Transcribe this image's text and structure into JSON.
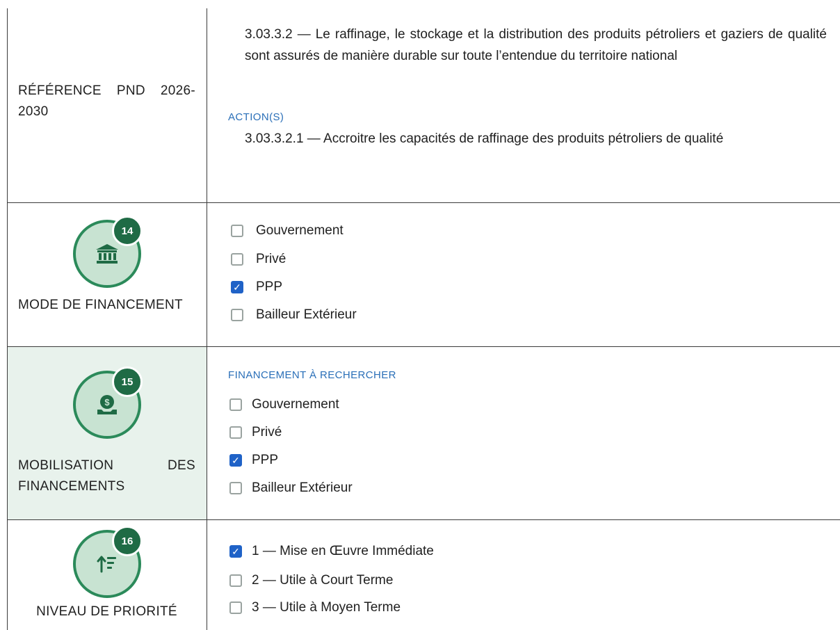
{
  "reference": {
    "label": "RÉFÉRENCE PND 2026-2030",
    "objective": "3.03.3.2 — Le raffinage, le stockage et la distribution des produits pétroliers et gaziers de qualité sont assurés de manière durable sur toute l’entendue du territoire national",
    "actions_label": "ACTION(S)",
    "action": "3.03.3.2.1 — Accroitre les capacités de raffinage des produits pétroliers de qualité"
  },
  "mode_financement": {
    "number": "14",
    "icon": "bank-icon",
    "label": "MODE DE FINANCEMENT",
    "options": [
      {
        "label": "Gouvernement",
        "checked": false
      },
      {
        "label": "Privé",
        "checked": false
      },
      {
        "label": "PPP",
        "checked": true
      },
      {
        "label": "Bailleur Extérieur",
        "checked": false
      }
    ]
  },
  "mobilisation": {
    "number": "15",
    "icon": "money-hand-icon",
    "label": "MOBILISATION DES FINANCEMENTS",
    "section_label": "FINANCEMENT À RECHERCHER",
    "options": [
      {
        "label": "Gouvernement",
        "checked": false
      },
      {
        "label": "Privé",
        "checked": false
      },
      {
        "label": "PPP",
        "checked": true
      },
      {
        "label": "Bailleur Extérieur",
        "checked": false
      }
    ]
  },
  "priorite": {
    "number": "16",
    "icon": "sort-priority-icon",
    "label": "NIVEAU DE PRIORITÉ",
    "options": [
      {
        "label": "1 — Mise en Œuvre Immédiate",
        "checked": true
      },
      {
        "label": "2 — Utile à Court Terme",
        "checked": false
      },
      {
        "label": "3 — Utile à Moyen Terme",
        "checked": false
      }
    ]
  },
  "colors": {
    "accent_green": "#2b8a5a",
    "badge_green": "#1f6b45",
    "check_blue": "#1f62c7",
    "label_blue": "#2a6fb8"
  }
}
